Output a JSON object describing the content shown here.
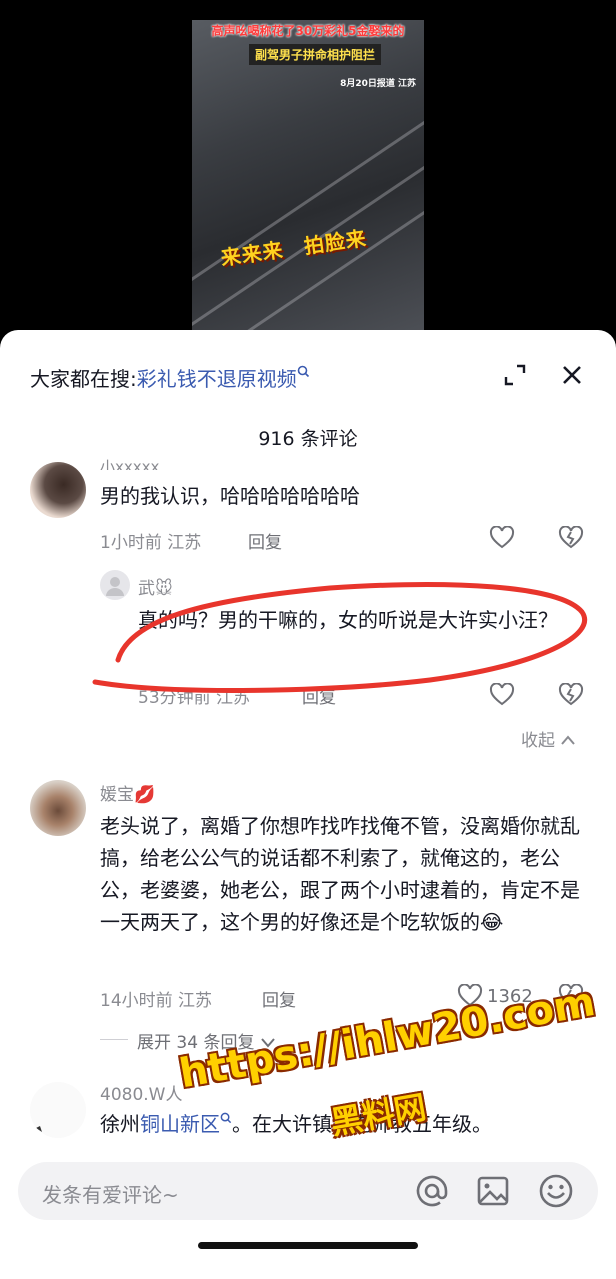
{
  "video": {
    "caption_top": "高声吆喝称花了30万彩礼5金娶来的",
    "caption_sub": "副驾男子拼命相护阻拦",
    "date_tag": "8月20日报道 江苏",
    "big_caption": "来来来　拍脸来"
  },
  "search": {
    "prefix": "大家都在搜:",
    "keyword": "彩礼钱不退原视频"
  },
  "comments_count": "916 条评论",
  "comments": [
    {
      "username": "小xxxxx",
      "text": "男的我认识，哈哈哈哈哈哈哈",
      "meta": "1小时前 江苏",
      "reply_label": "回复"
    },
    {
      "username": "武🐭",
      "text": "真的吗？男的干嘛的，女的听说是大许实小汪？",
      "meta": "53分钟前 江苏",
      "reply_label": "回复"
    },
    {
      "username": "媛宝💋",
      "text": "老头说了，离婚了你想咋找咋找俺不管，没离婚你就乱搞，给老公公气的说话都不利索了，就俺这的，老公公，老婆婆，她老公，跟了两个小时逮着的，肯定不是一天两天了，这个男的好像还是个吃软饭的😂",
      "meta": "14小时前 江苏",
      "reply_label": "回复",
      "likes": "1362",
      "expand_label": "展开 34 条回复"
    },
    {
      "username": "4080.W人",
      "text_prefix": "徐州",
      "text_link": "铜山新区",
      "text_suffix": "。在大许镇当老师教五年级。"
    }
  ],
  "collapse_label": "收起",
  "input": {
    "placeholder": "发条有爱评论~"
  },
  "watermark": {
    "line1": "https://ihlw20.com",
    "line2": "黑料网"
  },
  "colors": {
    "link": "#3b5bb0",
    "annotation": "#e8352c",
    "watermark": "#ffd000"
  }
}
